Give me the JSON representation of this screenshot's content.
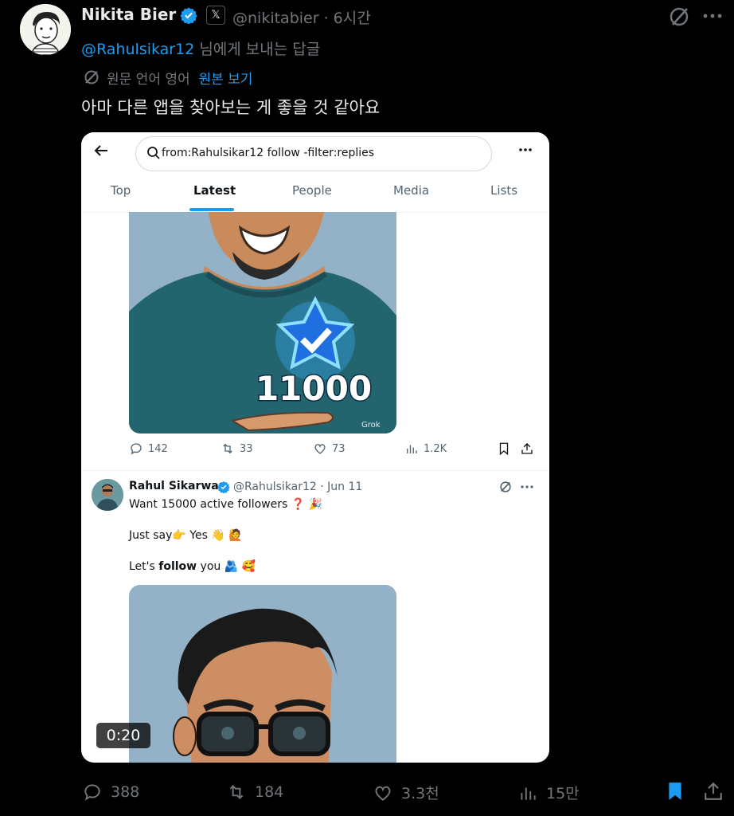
{
  "tweet": {
    "author_name": "Nikita Bier",
    "handle_time": "@nikitabier · 6시간",
    "replying_prefix": "@Rahulsikar12",
    "replying_suffix": " 님에게 보내는 답글",
    "translation_note": "원문 언어 영어",
    "translation_link": "원본 보기",
    "text": "아마 다른 앱을 찾아보는 게 좋을 것 같아요",
    "x_badge": "𝕏"
  },
  "card": {
    "search_query": "from:Rahulsikar12 follow -filter:replies",
    "tabs": [
      "Top",
      "Latest",
      "People",
      "Media",
      "Lists"
    ],
    "active_tab": "Latest",
    "image1_caption": "11000",
    "image1_watermark": "Grok",
    "actions": {
      "replies": "142",
      "reposts": "33",
      "likes": "73",
      "views": "1.2K"
    },
    "reply": {
      "name": "Rahul Sikarwar",
      "handle_date": "@Rahulsikar12 · Jun 11",
      "line1": "Want 15000 active followers ❓ 🎉",
      "line2": "Just say👉 Yes 👋 🙋",
      "line3_prefix": "Let's ",
      "line3_bold": "follow",
      "line3_suffix": " you 🫂  🥰"
    },
    "video_time": "0:20"
  },
  "bottom_actions": {
    "replies": "388",
    "reposts": "184",
    "likes": "3.3천",
    "views": "15만"
  },
  "colors": {
    "accent": "#1d9bf0",
    "muted": "#71767b",
    "background": "#000000"
  },
  "icons": [
    "grok-icon",
    "more-icon",
    "verified-icon",
    "reply-icon",
    "repost-icon",
    "like-icon",
    "views-icon",
    "bookmark-icon",
    "share-icon",
    "back-icon",
    "search-icon"
  ]
}
